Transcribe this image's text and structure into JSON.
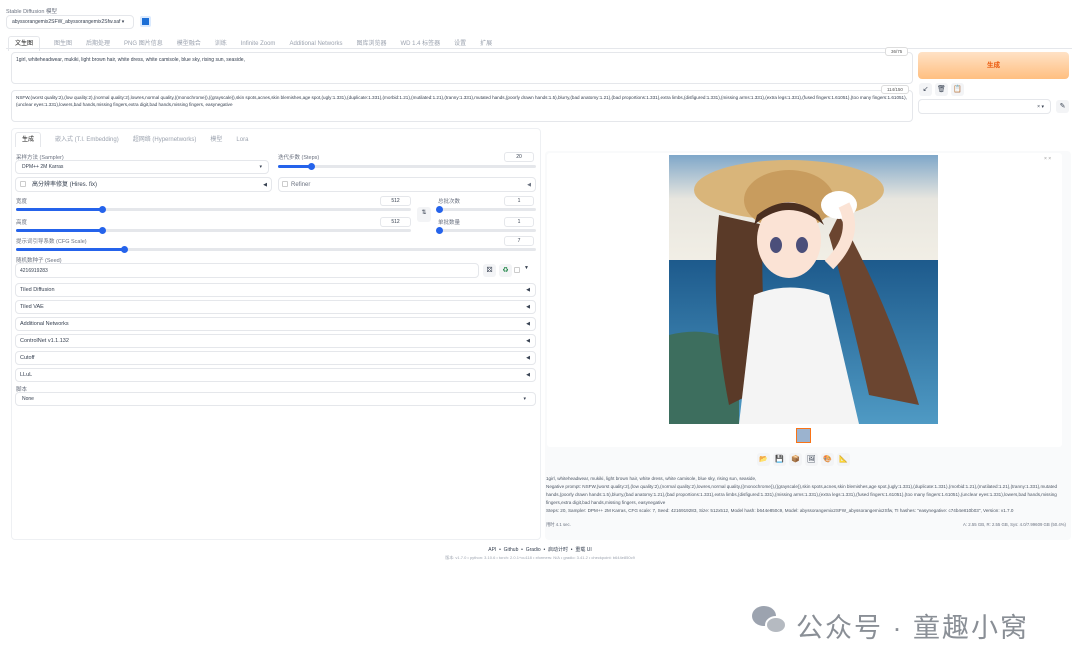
{
  "model": {
    "label": "Stable Diffusion 模型",
    "value": "abyssorangemix2SFW_abyssorangemix2Sfw.saf"
  },
  "tabs": [
    "文生图",
    "图生图",
    "后期处理",
    "PNG 图片信息",
    "模型融合",
    "训练",
    "Infinite Zoom",
    "Additional Networks",
    "图库浏览器",
    "WD 1.4 标签器",
    "设置",
    "扩展"
  ],
  "prompt": {
    "text": "1girl, whiteheadwear, mukiki, light brown hair, white dress, white camisole, blue sky, rising sun, seaside,",
    "counter": "36/75"
  },
  "negative": {
    "text": "NSFW,(worst quality:2),(low quality:2),(normal quality:2),lowres,normal quality,((monochrome)),((grayscale)),skin spots,acnes,skin blemishes,age spot,(ugly:1.331),(duplicate:1.331),(morbid:1.21),(mutilated:1.21),(tranny:1.331),mutated hands,(poorly drawn hands:1.5),blurry,(bad anatomy:1.21),(bad proportions:1.331),extra limbs,(disfigured:1.331),(missing arms:1.331),(extra legs:1.331),(fused fingers:1.61051),(too many fingers:1.61051),(unclear eyes:1.331),lowers,bad hands,missing fingers,extra digit,bad hands,missing fingers, easynegative",
    "counter": "114/150"
  },
  "generate_label": "生成",
  "subtabs": [
    "生成",
    "嵌入式 (T.I. Embedding)",
    "超网络 (Hypernetworks)",
    "模型",
    "Lora"
  ],
  "sampler": {
    "label": "采样方法 (Sampler)",
    "value": "DPM++ 2M Karras"
  },
  "steps": {
    "label": "迭代步数 (Steps)",
    "value": "20",
    "fraction": 0.13
  },
  "hires": "高分辨率修复 (Hires. fix)",
  "refiner": "Refiner",
  "width": {
    "label": "宽度",
    "value": "512",
    "fraction": 0.22
  },
  "height": {
    "label": "高度",
    "value": "512",
    "fraction": 0.22
  },
  "batch_count": {
    "label": "总批次数",
    "value": "1",
    "fraction": 0
  },
  "batch_size": {
    "label": "单批数量",
    "value": "1",
    "fraction": 0
  },
  "cfg": {
    "label": "提示词引导系数 (CFG Scale)",
    "value": "7",
    "fraction": 0.21
  },
  "seed": {
    "label": "随机数种子 (Seed)",
    "value": "4216919283"
  },
  "accordions": [
    "Tiled Diffusion",
    "Tiled VAE",
    "Additional Networks",
    "ControlNet v1.1.132",
    "Cutoff",
    "LLuL"
  ],
  "script": {
    "label": "脚本",
    "value": "None"
  },
  "info": {
    "line1": "1girl, whiteheadwear, mukiki, light brown hair, white dress, white camisole, blue sky, rising sun, seaside,",
    "line2": "Negative prompt: NSFW,(worst quality:2),(low quality:2),(normal quality:2),lowres,normal quality,((monochrome)),((grayscale)),skin spots,acnes,skin blemishes,age spot,(ugly:1.331),(duplicate:1.331),(morbid:1.21),(mutilated:1.21),(tranny:1.331),mutated hands,(poorly drawn hands:1.5),blurry,(bad anatomy:1.21),(bad proportions:1.331),extra limbs,(disfigured:1.331),(missing arms:1.331),(extra legs:1.331),(fused fingers:1.61051),(too many fingers:1.61051),(unclear eyes:1.331),lowers,bad hands,missing fingers,extra digit,bad hands,missing fingers, easynegative",
    "line3": "Steps: 20, Sampler: DPM++ 2M Karras, CFG scale: 7, Seed: 4216919283, Size: 512x512, Model hash: b644e850c9, Model: abyssorangemix2SFW_abyssorangemix2Sfw, TI hashes: \"easynegative: c74b4e810b03\", Version: v1.7.0",
    "time": "用时 4.1 sec.",
    "vram": "A: 2.55 GB, R: 2.55 GB, Sys: 4.0/7.99609 GB (50.4%)"
  },
  "footer": {
    "links": [
      "API",
      "Github",
      "Gradio",
      "启动计时",
      "重载 UI"
    ],
    "versions": "版本: v1.7.0  •  python: 3.10.6  •  torch: 2.0.1+cu118  •  xformers: N/A  •  gradio: 3.41.2  •  checkpoint: b644e850c9"
  },
  "watermark": "公众号 · 童趣小窝"
}
